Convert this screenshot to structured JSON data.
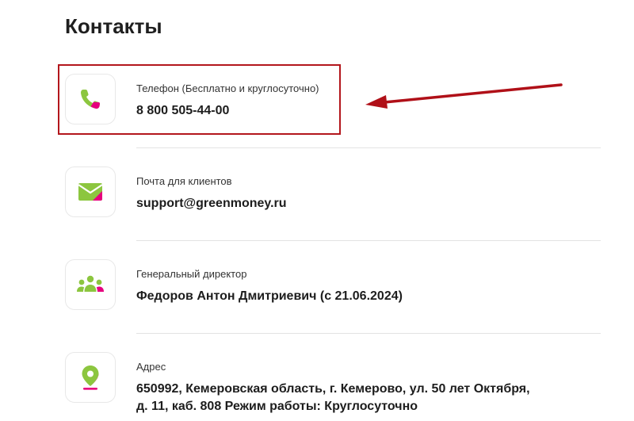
{
  "page": {
    "title": "Контакты"
  },
  "contacts": [
    {
      "label": "Телефон (Бесплатно и круглосуточно)",
      "value": "8 800 505-44-00",
      "icon": "phone-icon"
    },
    {
      "label": "Почта для клиентов",
      "value": "support@greenmoney.ru",
      "icon": "mail-icon"
    },
    {
      "label": "Генеральный директор",
      "value": "Федоров Антон Дмитриевич (с 21.06.2024)",
      "icon": "people-icon"
    },
    {
      "label": "Адрес",
      "value": "650992, Кемеровская область, г. Кемерово, ул. 50 лет Октября, д. 11, каб. 808 Режим работы: Круглосуточно",
      "icon": "location-pin-icon"
    }
  ],
  "colors": {
    "icon_green": "#8cc63f",
    "icon_pink": "#e6007e",
    "highlight_red": "#b3161c",
    "arrow_red": "#b01018"
  }
}
